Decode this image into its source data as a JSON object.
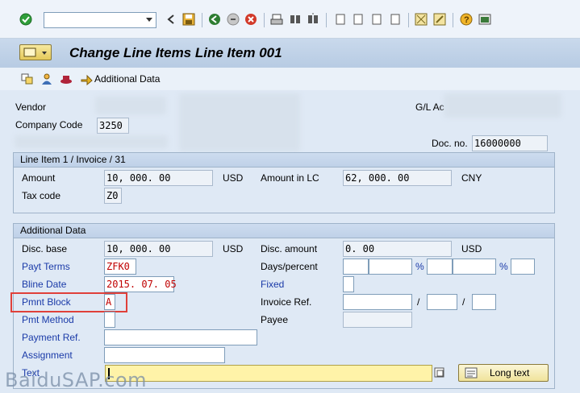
{
  "window": {
    "title": "Change Line Items Line Item 001"
  },
  "toolbar": {
    "command_value": "",
    "icons": [
      "enter-icon",
      "back-icon",
      "save-icon",
      "exit-icon",
      "logoff-icon",
      "cancel-icon",
      "print-icon",
      "find-icon",
      "find-next-icon",
      "first-page-icon",
      "previous-page-icon",
      "next-page-icon",
      "last-page-icon",
      "new-session-icon",
      "shortcut-icon",
      "help-icon",
      "layout-icon"
    ]
  },
  "app_toolbar": {
    "additional_data_label": "Additional Data"
  },
  "header": {
    "vendor_label": "Vendor",
    "company_code_label": "Company Code",
    "company_code_value": "3250",
    "gl_label": "G/L Ac",
    "doc_no_label": "Doc. no.",
    "doc_no_value": "16000000"
  },
  "line_item_group": {
    "title": "Line Item 1 / Invoice / 31",
    "amount_label": "Amount",
    "amount_value": "10, 000. 00",
    "amount_currency": "USD",
    "amount_lc_label": "Amount in LC",
    "amount_lc_value": "62, 000. 00",
    "amount_lc_currency": "CNY",
    "tax_code_label": "Tax code",
    "tax_code_value": "Z0"
  },
  "additional_group": {
    "title": "Additional Data",
    "disc_base_label": "Disc. base",
    "disc_base_value": "10, 000. 00",
    "disc_base_currency": "USD",
    "disc_amount_label": "Disc. amount",
    "disc_amount_value": "0. 00",
    "disc_amount_currency": "USD",
    "payt_terms_label": "Payt Terms",
    "payt_terms_value": "ZFK0",
    "days_percent_label": "Days/percent",
    "percent_sign": "%",
    "bline_date_label": "Bline Date",
    "bline_date_value": "2015. 07. 05",
    "fixed_label": "Fixed",
    "pmnt_block_label": "Pmnt Block",
    "pmnt_block_value": "A",
    "invoice_ref_label": "Invoice Ref.",
    "slash": "/",
    "pmt_method_label": "Pmt Method",
    "payee_label": "Payee",
    "payment_ref_label": "Payment Ref.",
    "assignment_label": "Assignment",
    "text_label": "Text",
    "long_text_label": "Long text"
  },
  "watermark": "BaiduSAP.com",
  "colors": {
    "accent_highlight": "#e0403a",
    "link_label": "#1a3aa8",
    "required_value": "#c00000"
  }
}
